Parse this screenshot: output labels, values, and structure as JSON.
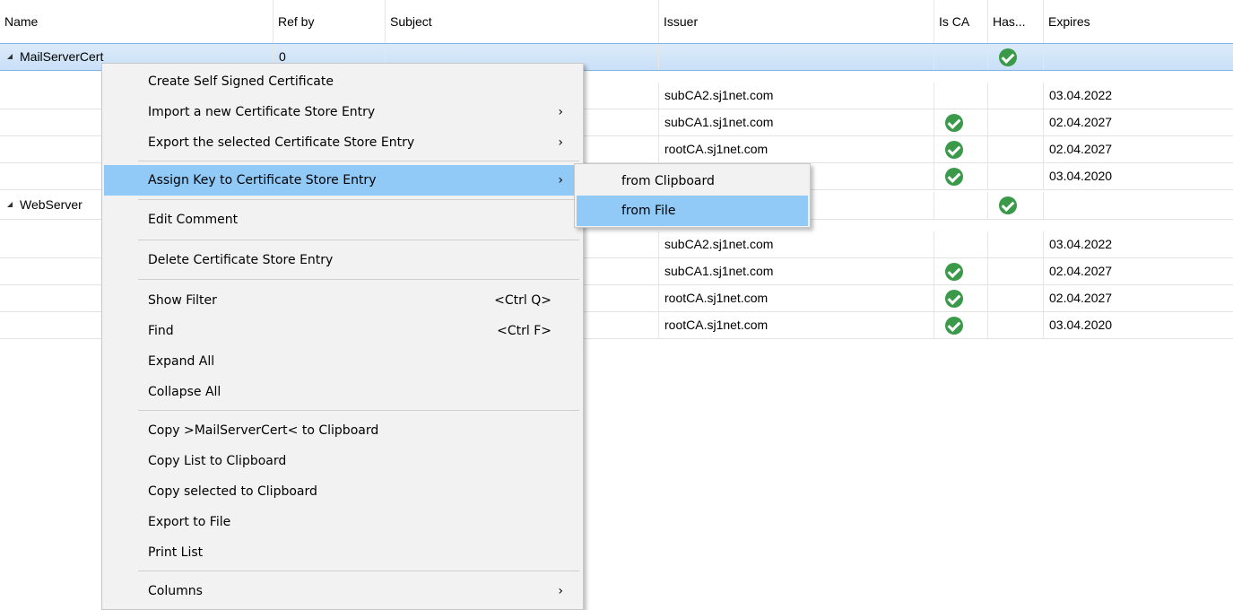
{
  "columns": [
    "Name",
    "Ref by",
    "Subject",
    "Issuer",
    "Is CA",
    "Has...",
    "Expires"
  ],
  "rows": [
    {
      "name": "MailServerCert",
      "refby": "0",
      "issuer": "",
      "isca": false,
      "has": true,
      "expires": "",
      "group": true
    },
    {
      "name": "",
      "refby": "",
      "issuer": "subCA2.sj1net.com",
      "isca": false,
      "has": false,
      "expires": "03.04.2022"
    },
    {
      "name": "",
      "refby": "",
      "issuer": "subCA1.sj1net.com",
      "isca": true,
      "has": false,
      "expires": "02.04.2027"
    },
    {
      "name": "",
      "refby": "",
      "issuer": "rootCA.sj1net.com",
      "isca": true,
      "has": false,
      "expires": "02.04.2027"
    },
    {
      "name": "",
      "refby": "",
      "issuer": "",
      "isca": true,
      "has": false,
      "expires": "03.04.2020"
    },
    {
      "name": "WebServer",
      "refby": "",
      "issuer": "",
      "isca": false,
      "has": true,
      "expires": "",
      "group": true
    },
    {
      "name": "",
      "refby": "",
      "issuer": "subCA2.sj1net.com",
      "isca": false,
      "has": false,
      "expires": "03.04.2022"
    },
    {
      "name": "",
      "refby": "",
      "issuer": "subCA1.sj1net.com",
      "isca": true,
      "has": false,
      "expires": "02.04.2027"
    },
    {
      "name": "",
      "refby": "",
      "issuer": "rootCA.sj1net.com",
      "isca": true,
      "has": false,
      "expires": "02.04.2027"
    },
    {
      "name": "",
      "refby": "",
      "issuer": "rootCA.sj1net.com",
      "isca": true,
      "has": false,
      "expires": "03.04.2020"
    }
  ],
  "menu": {
    "create_self_signed": "Create Self Signed Certificate",
    "import_entry": "Import a new Certificate Store Entry",
    "export_selected": "Export the selected Certificate Store Entry",
    "assign_key": "Assign Key to Certificate Store Entry",
    "edit_comment": "Edit Comment",
    "delete_entry": "Delete Certificate Store Entry",
    "show_filter": "Show Filter",
    "show_filter_shortcut": "<Ctrl Q>",
    "find": "Find",
    "find_shortcut": "<Ctrl F>",
    "expand_all": "Expand All",
    "collapse_all": "Collapse All",
    "copy_name": "Copy >MailServerCert< to Clipboard",
    "copy_list": "Copy List to Clipboard",
    "copy_selected": "Copy selected to Clipboard",
    "export_file": "Export to File",
    "print_list": "Print List",
    "columns": "Columns",
    "arrow": "›"
  },
  "submenu": {
    "from_clipboard": "from Clipboard",
    "from_file": "from File"
  },
  "colors": {
    "accent": "#91c9f7",
    "check": "#3a9a4a"
  }
}
